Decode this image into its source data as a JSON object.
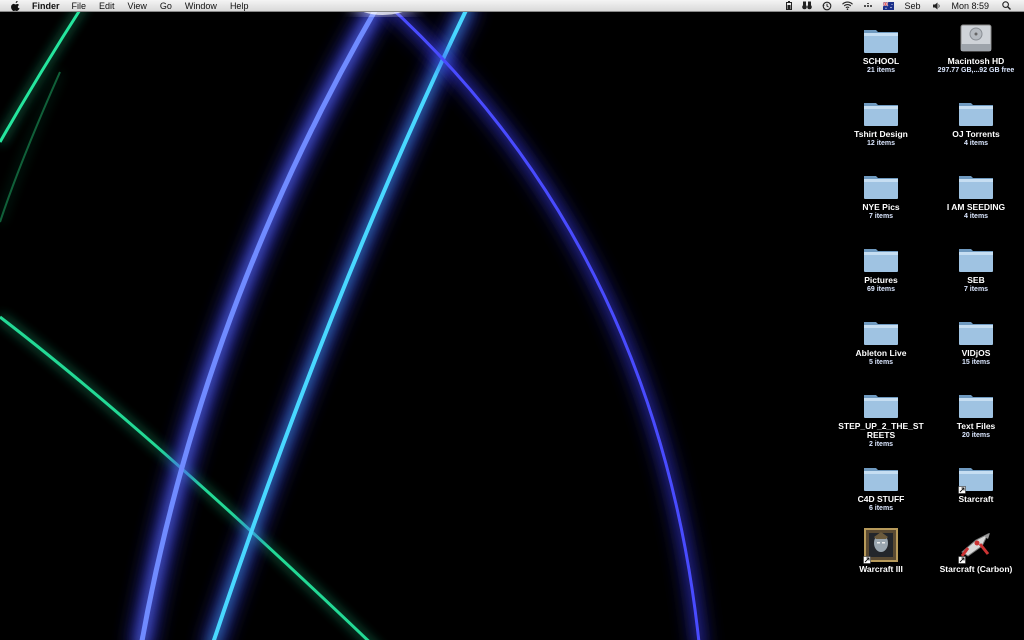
{
  "menubar": {
    "app_name": "Finder",
    "menus": [
      "File",
      "Edit",
      "View",
      "Go",
      "Window",
      "Help"
    ],
    "user": "Seb",
    "clock": "Mon 8:59"
  },
  "desktop": {
    "items": [
      {
        "name": "SCHOOL",
        "info": "21 items",
        "kind": "folder"
      },
      {
        "name": "Macintosh HD",
        "info": "297.77 GB,...92 GB free",
        "kind": "drive"
      },
      {
        "name": "Tshirt Design",
        "info": "12 items",
        "kind": "folder"
      },
      {
        "name": "OJ Torrents",
        "info": "4 items",
        "kind": "folder"
      },
      {
        "name": "NYE Pics",
        "info": "7 items",
        "kind": "folder"
      },
      {
        "name": "I AM SEEDING",
        "info": "4 items",
        "kind": "folder"
      },
      {
        "name": "Pictures",
        "info": "69 items",
        "kind": "folder"
      },
      {
        "name": "SEB",
        "info": "7 items",
        "kind": "folder"
      },
      {
        "name": "Ableton Live",
        "info": "5 items",
        "kind": "folder"
      },
      {
        "name": "VIDjOS",
        "info": "15 items",
        "kind": "folder"
      },
      {
        "name": "STEP_UP_2_THE_STREETS",
        "info": "2 items",
        "kind": "folder"
      },
      {
        "name": "Text Files",
        "info": "20 items",
        "kind": "folder"
      },
      {
        "name": "C4D STUFF",
        "info": "6 items",
        "kind": "folder"
      },
      {
        "name": "Starcraft",
        "info": "",
        "kind": "folder-alias"
      },
      {
        "name": "Warcraft III",
        "info": "",
        "kind": "warcraft-app"
      },
      {
        "name": "Starcraft (Carbon)",
        "info": "",
        "kind": "starcraft-app"
      }
    ]
  },
  "colors": {
    "folder": "#9fc3e2",
    "folder_dark": "#6f9ac0",
    "beam_blue": "#3a3cff",
    "beam_cyan": "#38e8ff",
    "beam_green": "#2bff9a"
  }
}
